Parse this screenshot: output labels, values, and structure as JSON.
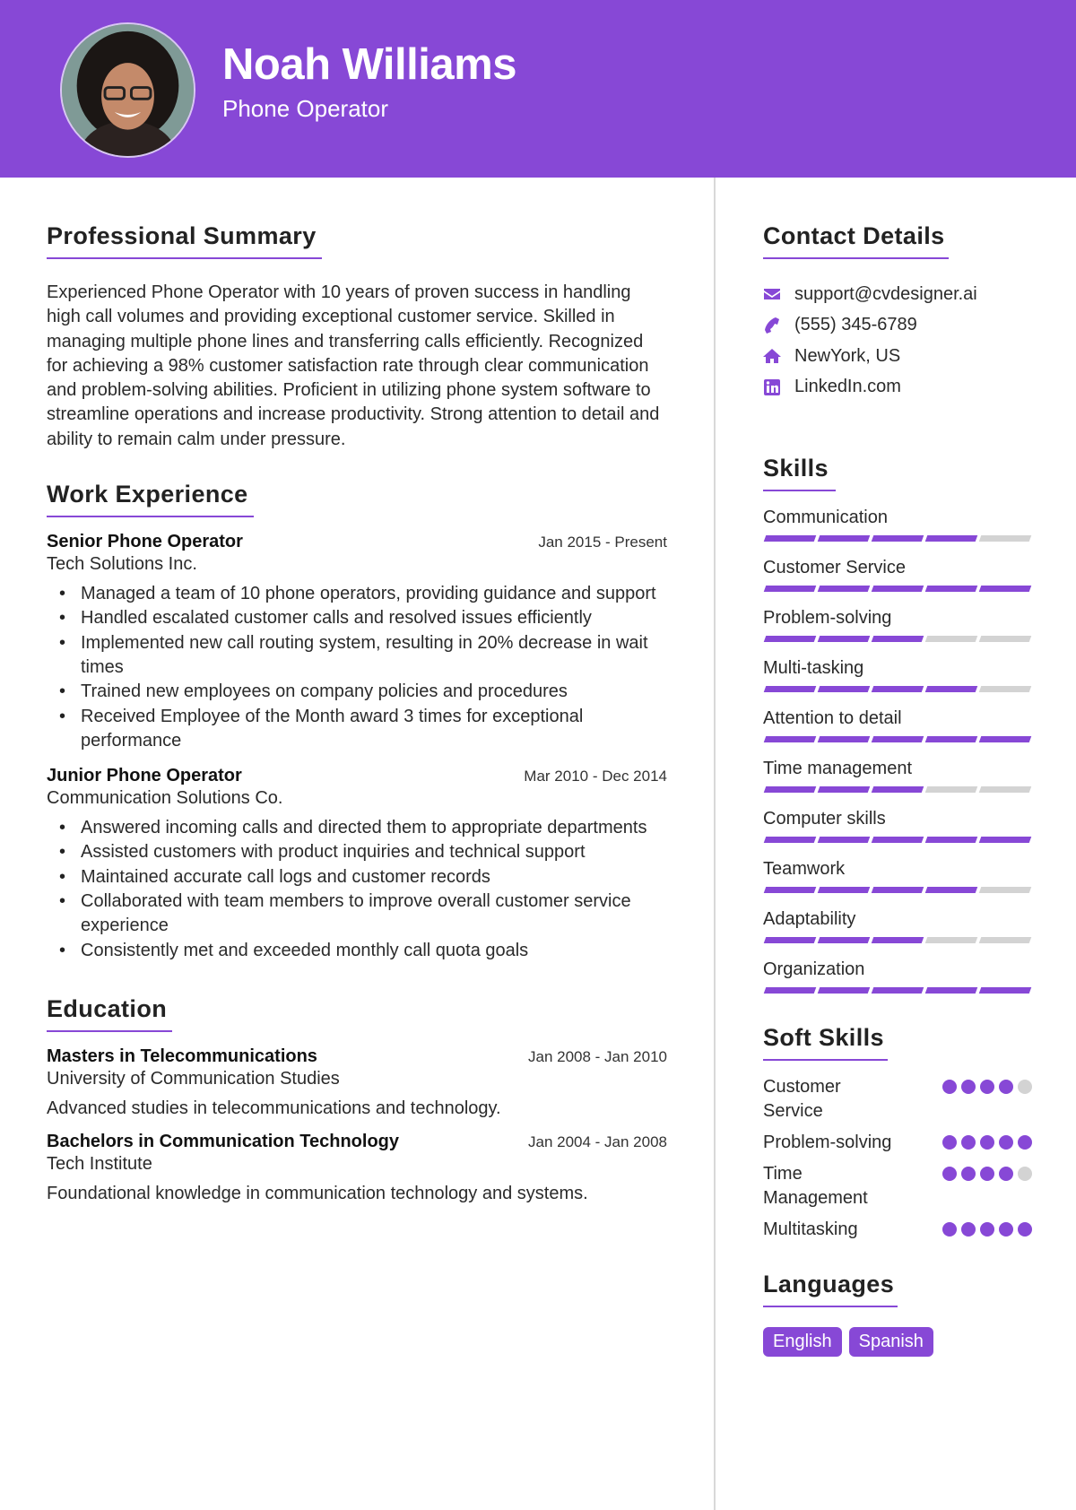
{
  "header": {
    "name": "Noah Williams",
    "role": "Phone Operator",
    "accent_color": "#8748d6"
  },
  "summary": {
    "title": "Professional Summary",
    "text": "Experienced Phone Operator with 10 years of proven success in handling high call volumes and providing exceptional customer service. Skilled in managing multiple phone lines and transferring calls efficiently. Recognized for achieving a 98% customer satisfaction rate through clear communication and problem-solving abilities. Proficient in utilizing phone system software to streamline operations and increase productivity. Strong attention to detail and ability to remain calm under pressure."
  },
  "experience": {
    "title": "Work Experience",
    "jobs": [
      {
        "title": "Senior Phone Operator",
        "date": "Jan 2015 - Present",
        "company": "Tech Solutions Inc.",
        "bullets": [
          "Managed a team of 10 phone operators, providing guidance and support",
          "Handled escalated customer calls and resolved issues efficiently",
          "Implemented new call routing system, resulting in 20% decrease in wait times",
          "Trained new employees on company policies and procedures",
          "Received Employee of the Month award 3 times for exceptional performance"
        ]
      },
      {
        "title": "Junior Phone Operator",
        "date": "Mar 2010 - Dec 2014",
        "company": "Communication Solutions Co.",
        "bullets": [
          "Answered incoming calls and directed them to appropriate departments",
          "Assisted customers with product inquiries and technical support",
          "Maintained accurate call logs and customer records",
          "Collaborated with team members to improve overall customer service experience",
          "Consistently met and exceeded monthly call quota goals"
        ]
      }
    ]
  },
  "education": {
    "title": "Education",
    "items": [
      {
        "degree": "Masters in Telecommunications",
        "date": "Jan 2008 - Jan 2010",
        "school": "University of Communication Studies",
        "description": "Advanced studies in telecommunications and technology."
      },
      {
        "degree": "Bachelors in Communication Technology",
        "date": "Jan 2004 - Jan 2008",
        "school": "Tech Institute",
        "description": "Foundational knowledge in communication technology and systems."
      }
    ]
  },
  "contact": {
    "title": "Contact Details",
    "items": [
      {
        "icon": "envelope-icon",
        "text": "support@cvdesigner.ai"
      },
      {
        "icon": "phone-icon",
        "text": "(555) 345-6789"
      },
      {
        "icon": "home-icon",
        "text": "NewYork, US"
      },
      {
        "icon": "linkedin-icon",
        "text": "LinkedIn.com"
      }
    ]
  },
  "skills": {
    "title": "Skills",
    "max": 5,
    "items": [
      {
        "name": "Communication",
        "level": 4
      },
      {
        "name": "Customer Service",
        "level": 5
      },
      {
        "name": "Problem-solving",
        "level": 3
      },
      {
        "name": "Multi-tasking",
        "level": 4
      },
      {
        "name": "Attention to detail",
        "level": 5
      },
      {
        "name": "Time management",
        "level": 3
      },
      {
        "name": "Computer skills",
        "level": 5
      },
      {
        "name": "Teamwork",
        "level": 4
      },
      {
        "name": "Adaptability",
        "level": 3
      },
      {
        "name": "Organization",
        "level": 5
      }
    ]
  },
  "soft_skills": {
    "title": "Soft Skills",
    "max": 5,
    "items": [
      {
        "name": "Customer Service",
        "level": 4
      },
      {
        "name": "Problem-solving",
        "level": 5
      },
      {
        "name": "Time Management",
        "level": 4
      },
      {
        "name": "Multitasking",
        "level": 5
      }
    ]
  },
  "languages": {
    "title": "Languages",
    "items": [
      "English",
      "Spanish"
    ]
  }
}
